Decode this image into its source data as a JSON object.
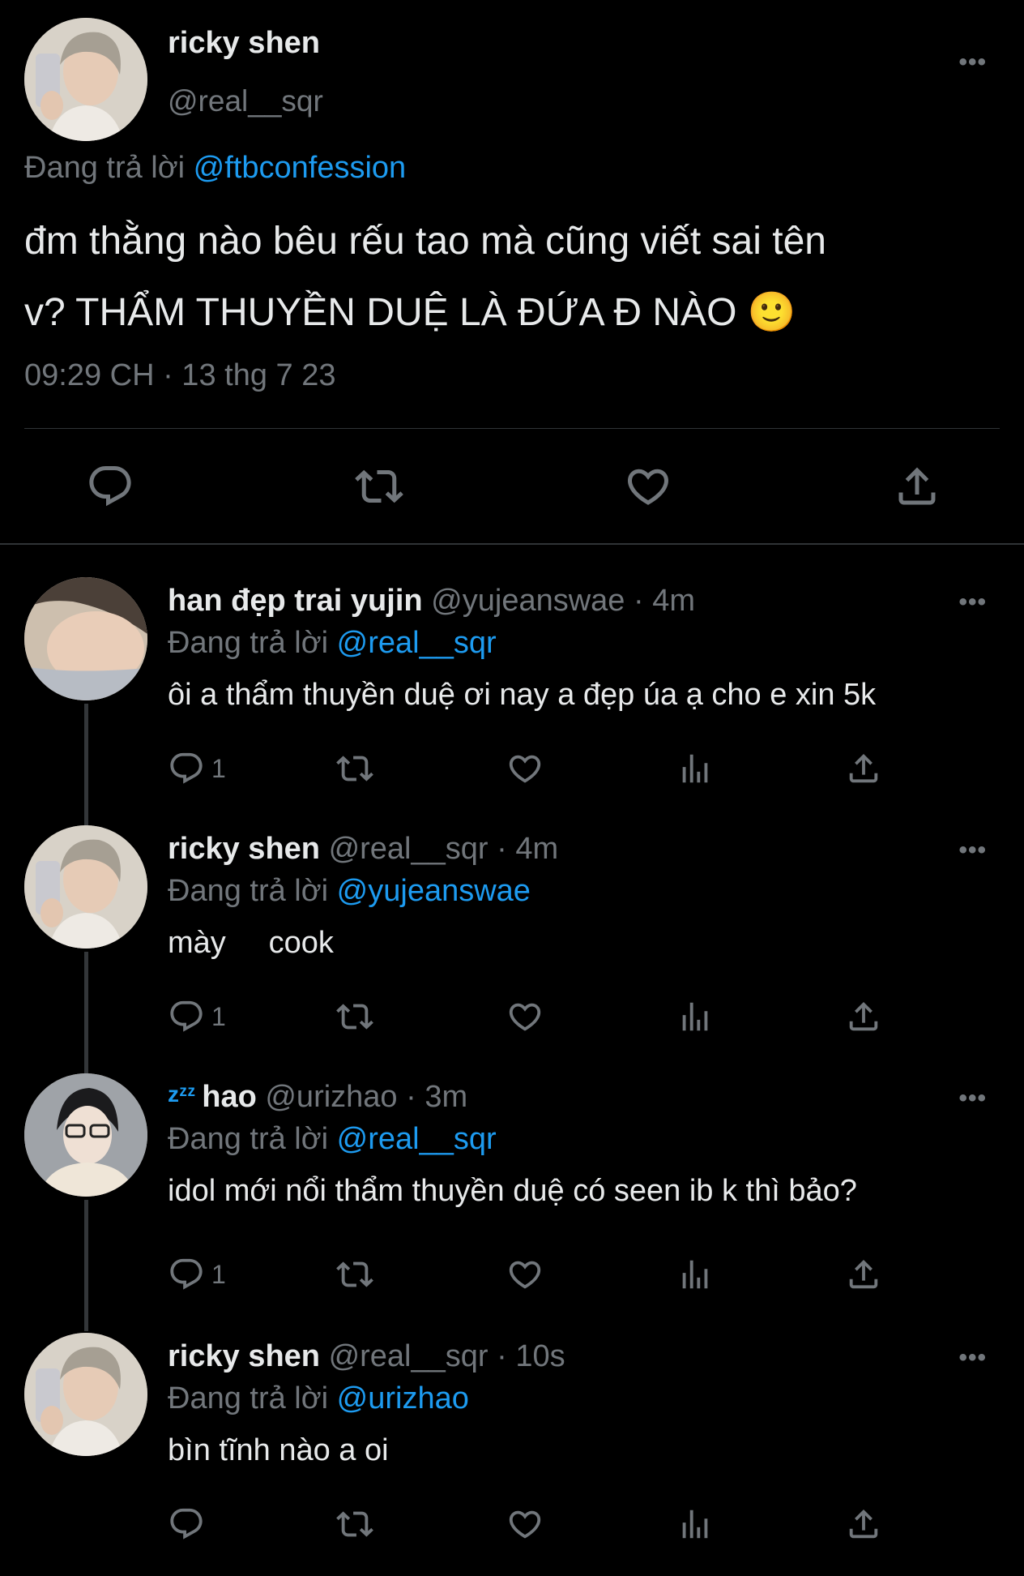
{
  "main_tweet": {
    "name": "ricky shen",
    "handle": "@real__sqr",
    "replying_prefix": "Đang trả lời",
    "replying_to": "@ftbconfession",
    "text_line1": "đm thằng nào bêu rếu tao mà cũng viết sai tên",
    "text_line2": "v? THẨM THUYỀN DUỆ LÀ ĐỨA Đ NÀO 🙂",
    "timestamp": "09:29 CH · 13 thg 7 23"
  },
  "replies": [
    {
      "name": "han đẹp trai yujin",
      "handle": "@yujeanswae",
      "time": "· 4m",
      "replying_prefix": "Đang trả lời",
      "replying_to": "@real__sqr",
      "text": "ôi a thẩm thuyền duệ ơi nay a đẹp úa ạ cho e xin 5k",
      "reply_count": "1"
    },
    {
      "name": "ricky shen",
      "handle": "@real__sqr",
      "time": "· 4m",
      "replying_prefix": "Đang trả lời",
      "replying_to": "@yujeanswae",
      "text": "mày     cook",
      "reply_count": "1"
    },
    {
      "name_prefix": "zᶻᶻ",
      "name": "hao",
      "handle": "@urizhao",
      "time": "· 3m",
      "replying_prefix": "Đang trả lời",
      "replying_to": "@real__sqr",
      "text": "idol mới nổi thẩm thuyền duệ có seen ib k thì bảo?",
      "reply_count": "1"
    },
    {
      "name": "ricky shen",
      "handle": "@real__sqr",
      "time": "· 10s",
      "replying_prefix": "Đang trả lời",
      "replying_to": "@urizhao",
      "text": "bìn tĩnh nào a oi",
      "reply_count": ""
    }
  ],
  "more_label": "•••",
  "colors": {
    "background": "#000000",
    "text": "#e7e9ea",
    "muted": "#71767b",
    "link": "#1d9bf0",
    "divider": "#2f3336"
  }
}
